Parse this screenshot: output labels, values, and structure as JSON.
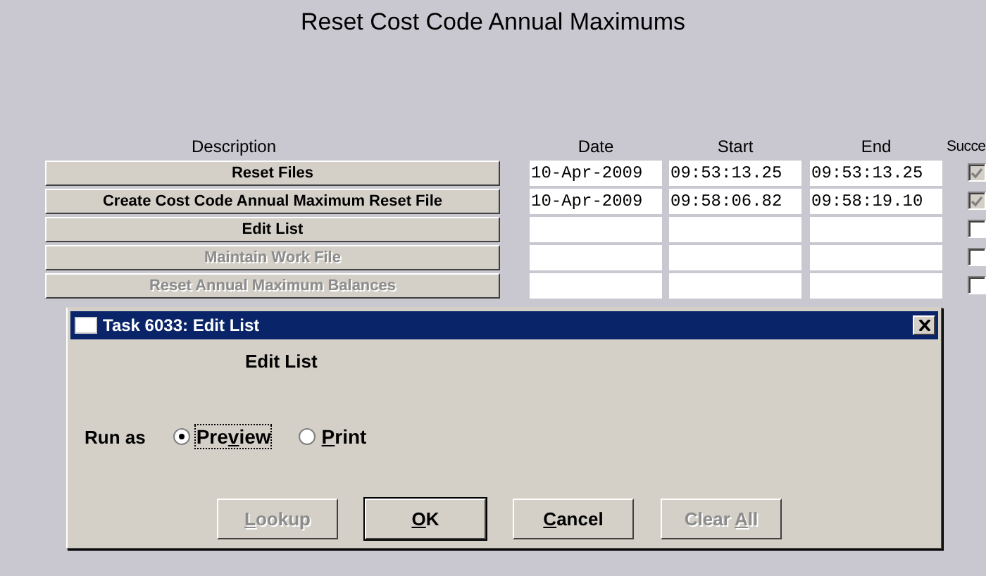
{
  "title": "Reset Cost Code Annual Maximums",
  "columns": {
    "description": "Description",
    "date": "Date",
    "start": "Start",
    "end": "End",
    "success": "Succe"
  },
  "rows": [
    {
      "description": "Reset Files",
      "disabled": false,
      "date": "10-Apr-2009",
      "start": "09:53:13.25",
      "end": "09:53:13.25",
      "success": true
    },
    {
      "description": "Create Cost Code Annual Maximum Reset File",
      "disabled": false,
      "date": "10-Apr-2009",
      "start": "09:58:06.82",
      "end": "09:58:19.10",
      "success": true
    },
    {
      "description": "Edit List",
      "disabled": false,
      "success": false
    },
    {
      "description": "Maintain Work File",
      "disabled": true,
      "success": false
    },
    {
      "description": "Reset Annual Maximum Balances",
      "disabled": true,
      "success": false
    }
  ],
  "dialog": {
    "title": "Task 6033: Edit List",
    "heading": "Edit List",
    "run_as_label": "Run as",
    "options": [
      {
        "label_before": "Pre",
        "label_underlined": "v",
        "label_after": "iew",
        "selected": true
      },
      {
        "label_underlined": "P",
        "label_after": "rint",
        "selected": false
      }
    ],
    "buttons": [
      {
        "label_underlined": "L",
        "label_after": "ookup",
        "disabled": true,
        "default": false
      },
      {
        "label_underlined": "O",
        "label_after": "K",
        "disabled": false,
        "default": true
      },
      {
        "label_underlined": "C",
        "label_after": "ancel",
        "disabled": false,
        "default": false
      },
      {
        "label_before": "Clear ",
        "label_underlined": "A",
        "label_after": "ll",
        "disabled": true,
        "default": false
      }
    ]
  }
}
